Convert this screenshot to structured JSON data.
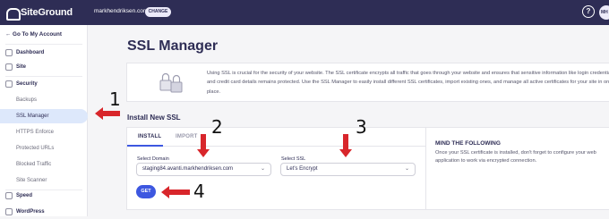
{
  "topbar": {
    "logo_text": "SiteGround",
    "account_name": "markhendriksen.com",
    "change_label": "CHANGE",
    "help_glyph": "?",
    "avatar_initials": "MH"
  },
  "sidebar": {
    "back_label": "← Go To My Account",
    "items": [
      {
        "label": "Dashboard",
        "icon": "dashboard-icon"
      },
      {
        "label": "Site",
        "icon": "site-icon"
      },
      {
        "label": "Security",
        "icon": "security-icon"
      },
      {
        "label": "Backups"
      },
      {
        "label": "SSL Manager"
      },
      {
        "label": "HTTPS Enforce"
      },
      {
        "label": "Protected URLs"
      },
      {
        "label": "Blocked Traffic"
      },
      {
        "label": "Site Scanner"
      },
      {
        "label": "Speed",
        "icon": "speed-icon"
      },
      {
        "label": "WordPress",
        "icon": "wordpress-icon"
      }
    ]
  },
  "main": {
    "title": "SSL Manager",
    "intro": "Using SSL is crucial for the security of your website. The SSL certificate encrypts all traffic that goes through your website and ensures that sensitive information like login credentials and credit card details remains protected. Use the SSL Manager to easily install different SSL certificates, import existing ones, and manage all active certificates for your site in one place.",
    "section_title": "Install New SSL",
    "tabs": [
      "INSTALL",
      "IMPORT"
    ],
    "domain_label": "Select Domain",
    "domain_value": "staging84.avanti.markhendriksen.com",
    "ssl_label": "Select SSL",
    "ssl_value": "Let's Encrypt",
    "get_label": "GET"
  },
  "aside": {
    "title": "MIND THE FOLLOWING",
    "text": "Once your SSL certificate is installed, don't forget to configure your web application to work via encrypted connection."
  },
  "callouts": [
    "1",
    "2",
    "3",
    "4"
  ],
  "colors": {
    "topbar": "#2e2d55",
    "accent": "#3d57e0",
    "annotation_arrow": "#d8262b"
  }
}
